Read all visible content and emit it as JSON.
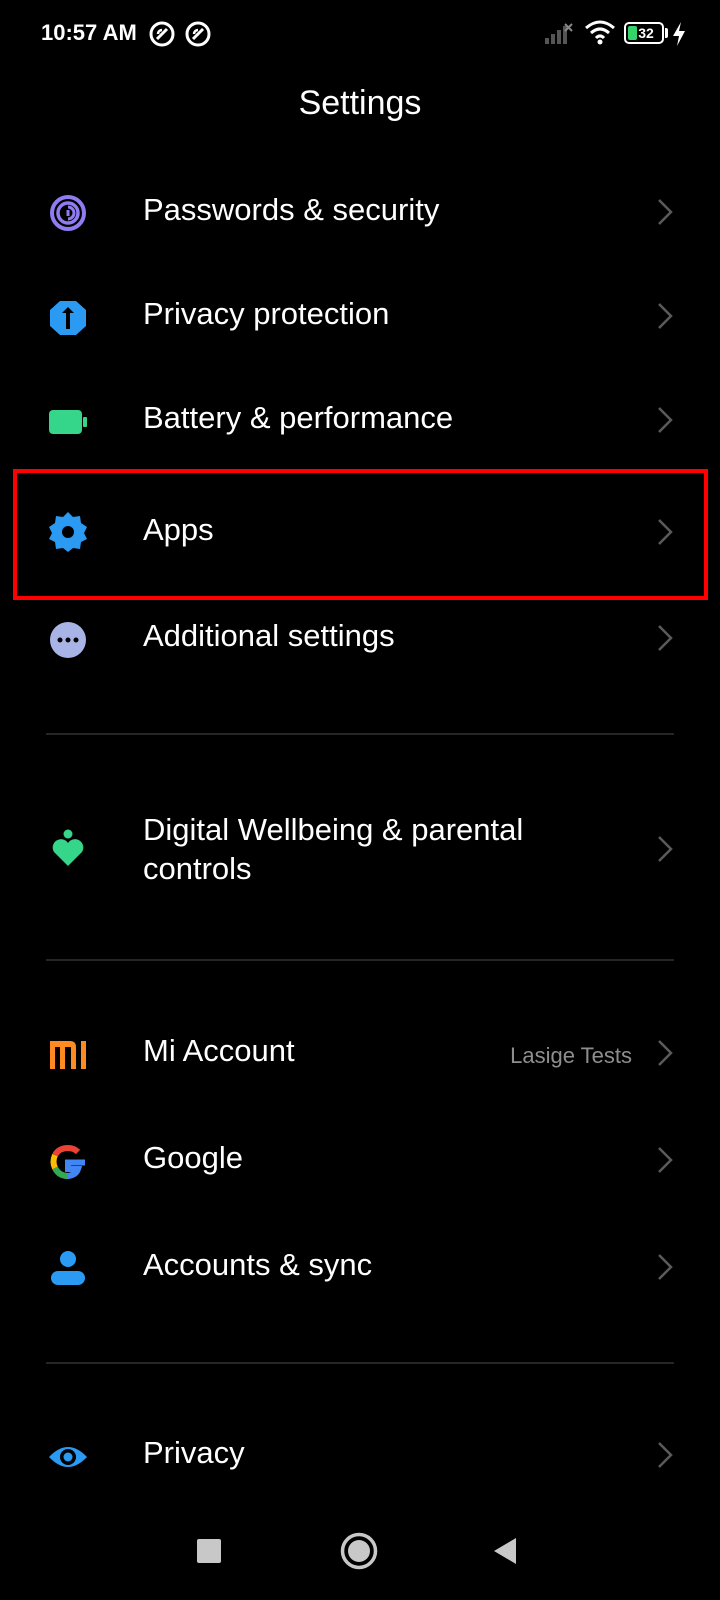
{
  "status_bar": {
    "time": "10:57 AM",
    "battery_level": "32",
    "notification_icons": [
      "notification-icon",
      "notification-icon"
    ]
  },
  "header": {
    "title": "Settings"
  },
  "settings": {
    "passwords": {
      "label": "Passwords & security",
      "icon": "fingerprint-icon",
      "color": "#8f7cf0"
    },
    "privacy_protection": {
      "label": "Privacy protection",
      "icon": "shield-icon",
      "color": "#2b9af3"
    },
    "battery": {
      "label": "Battery & performance",
      "icon": "battery-icon",
      "color": "#35d58a"
    },
    "apps": {
      "label": "Apps",
      "icon": "gear-icon",
      "color": "#2b9af3"
    },
    "additional": {
      "label": "Additional settings",
      "icon": "more-dots-icon",
      "color": "#a8b4e6"
    },
    "digital_wellbeing": {
      "label_line1": "Digital Wellbeing & parental",
      "label_line2": "controls",
      "icon": "wellbeing-heart-icon",
      "color": "#35d58a"
    },
    "mi_account": {
      "label": "Mi Account",
      "value": "Lasige Tests",
      "icon": "mi-logo-icon",
      "color": "#ff8a1f"
    },
    "google": {
      "label": "Google",
      "icon": "google-logo-icon"
    },
    "accounts_sync": {
      "label": "Accounts & sync",
      "icon": "person-icon",
      "color": "#2b9af3"
    },
    "privacy": {
      "label": "Privacy",
      "icon": "eye-icon",
      "color": "#2b9af3"
    }
  },
  "highlight": {
    "color": "#ff0000",
    "target": "Apps"
  },
  "nav_bar": {
    "buttons": [
      "recents-square-icon",
      "home-circle-icon",
      "back-triangle-icon"
    ]
  }
}
